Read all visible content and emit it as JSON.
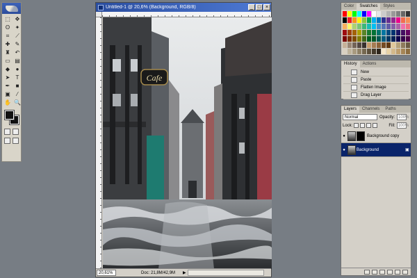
{
  "document": {
    "title": "Untitled-1 @ 20,6% (Background, RGB/8)",
    "zoom": "20,61%",
    "doc_info": "Doc: 21,8M/42,9M"
  },
  "window_controls": {
    "minimize": "_",
    "maximize": "□",
    "close": "×"
  },
  "tools": [
    {
      "name": "marquee",
      "glyph": "⬚"
    },
    {
      "name": "move",
      "glyph": "✥"
    },
    {
      "name": "lasso",
      "glyph": "ʘ"
    },
    {
      "name": "magic-wand",
      "glyph": "✦"
    },
    {
      "name": "crop",
      "glyph": "⌗"
    },
    {
      "name": "slice",
      "glyph": "⟋"
    },
    {
      "name": "healing-brush",
      "glyph": "✚"
    },
    {
      "name": "brush",
      "glyph": "✎"
    },
    {
      "name": "clone-stamp",
      "glyph": "♜"
    },
    {
      "name": "history-brush",
      "glyph": "↶"
    },
    {
      "name": "eraser",
      "glyph": "▭"
    },
    {
      "name": "gradient",
      "glyph": "▤"
    },
    {
      "name": "blur",
      "glyph": "◆"
    },
    {
      "name": "dodge",
      "glyph": "●"
    },
    {
      "name": "path-selection",
      "glyph": "➤"
    },
    {
      "name": "type",
      "glyph": "T"
    },
    {
      "name": "pen",
      "glyph": "✒"
    },
    {
      "name": "shape",
      "glyph": "■"
    },
    {
      "name": "notes",
      "glyph": "▣"
    },
    {
      "name": "eyedropper",
      "glyph": "⁄"
    },
    {
      "name": "hand",
      "glyph": "✋"
    },
    {
      "name": "zoom",
      "glyph": "🔍"
    }
  ],
  "color_panel": {
    "tabs": [
      "Color",
      "Swatches",
      "Styles"
    ],
    "active_tab": "Swatches",
    "swatch_colors": [
      "#ff0000",
      "#ffff00",
      "#00ff00",
      "#00ffff",
      "#0000ff",
      "#ff00ff",
      "#ffffff",
      "#e6e6e6",
      "#cccccc",
      "#b3b3b3",
      "#999999",
      "#808080",
      "#666666",
      "#333333",
      "#000000",
      "#ed1c24",
      "#f7941d",
      "#fff200",
      "#8dc63f",
      "#00a651",
      "#00aeef",
      "#0072bc",
      "#2e3192",
      "#662d91",
      "#92278f",
      "#ec008c",
      "#f26c4f",
      "#f68e56",
      "#fbaf5d",
      "#fff568",
      "#acd373",
      "#7cc576",
      "#3bb878",
      "#1abbb4",
      "#00bff3",
      "#448ccb",
      "#5674b9",
      "#605ca8",
      "#855fa8",
      "#a864a8",
      "#f06eaa",
      "#f26d7d",
      "#9e0b0f",
      "#a0410d",
      "#a36209",
      "#aba000",
      "#598527",
      "#1a7b30",
      "#007236",
      "#00746b",
      "#0076a3",
      "#004a80",
      "#003471",
      "#1b1464",
      "#440e62",
      "#630460",
      "#790000",
      "#7b2e00",
      "#7d4900",
      "#827b00",
      "#406618",
      "#005e20",
      "#005826",
      "#005952",
      "#005b7f",
      "#003663",
      "#002157",
      "#0d004c",
      "#32004b",
      "#4b0049",
      "#c7b299",
      "#998675",
      "#736357",
      "#534741",
      "#37302d",
      "#c69c6d",
      "#a67c52",
      "#8c6239",
      "#754c24",
      "#603913",
      "#e0c89a",
      "#b5a27a",
      "#8f7c5c",
      "#6b5a42",
      "#d9d0c0",
      "#bfb39b",
      "#a89a7f",
      "#8f8166",
      "#756850",
      "#5c503c",
      "#443a2b",
      "#2e261c",
      "#f5e6c8",
      "#e8d2a6",
      "#d4b98a",
      "#bf9f6e",
      "#a68656",
      "#8c6d40"
    ]
  },
  "history_panel": {
    "tabs": [
      "History",
      "Actions"
    ],
    "active_tab": "History",
    "items": [
      "New",
      "Paste",
      "Flatten Image",
      "Drag Layer"
    ]
  },
  "layers_panel": {
    "tabs": [
      "Layers",
      "Channels",
      "Paths"
    ],
    "active_tab": "Layers",
    "blend_mode": "Normal",
    "opacity_label": "Opacity:",
    "opacity_value": "100%",
    "lock_label": "Lock:",
    "fill_label": "Fill:",
    "fill_value": "100%",
    "layers": [
      {
        "name": "Background copy",
        "selected": false
      },
      {
        "name": "Background",
        "selected": true
      }
    ]
  },
  "canvas_content": {
    "cafe_sign": "Cafe"
  },
  "colors": {
    "title_bar": "#2a4d9f",
    "selected_layer": "#0a246a",
    "workspace": "#777d84"
  }
}
